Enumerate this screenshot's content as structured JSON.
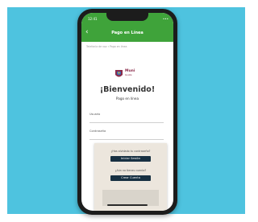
{
  "status": {
    "time": "12:41",
    "signal": "•••"
  },
  "appbar": {
    "title": "Pago en Línea"
  },
  "breadcrumb": {
    "part1": "Telefonía de voz",
    "part2": "Pago en línea"
  },
  "brand": {
    "name": "Muni",
    "sub": "Guate"
  },
  "welcome": {
    "title": "¡Bienvenido!",
    "subtitle": "Pago en línea"
  },
  "form": {
    "user_label": "Usuario",
    "password_label": "Contraseña"
  },
  "overlay": {
    "question1": "¿Has olvidado tu contraseña?",
    "login_button": "Iniciar Sesión",
    "question2": "¿Aún no tienes cuenta?",
    "create_button": "Crear Cuenta"
  }
}
